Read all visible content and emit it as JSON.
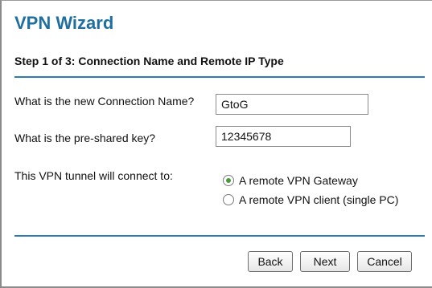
{
  "wizard": {
    "title": "VPN Wizard",
    "step_heading": "Step 1 of 3: Connection Name and Remote IP Type"
  },
  "form": {
    "connection_name_label": "What is the new Connection Name?",
    "connection_name_value": "GtoG",
    "preshared_key_label": "What is the pre-shared key?",
    "preshared_key_value": "12345678",
    "tunnel_label": "This VPN tunnel will connect to:",
    "options": [
      {
        "label": "A remote VPN Gateway",
        "selected": true
      },
      {
        "label": "A remote VPN client (single PC)",
        "selected": false
      }
    ]
  },
  "buttons": {
    "back": "Back",
    "next": "Next",
    "cancel": "Cancel"
  },
  "colors": {
    "title": "#1f6f9f",
    "rule": "#2b7bb5",
    "radio_selected": "#4a9a3a"
  }
}
